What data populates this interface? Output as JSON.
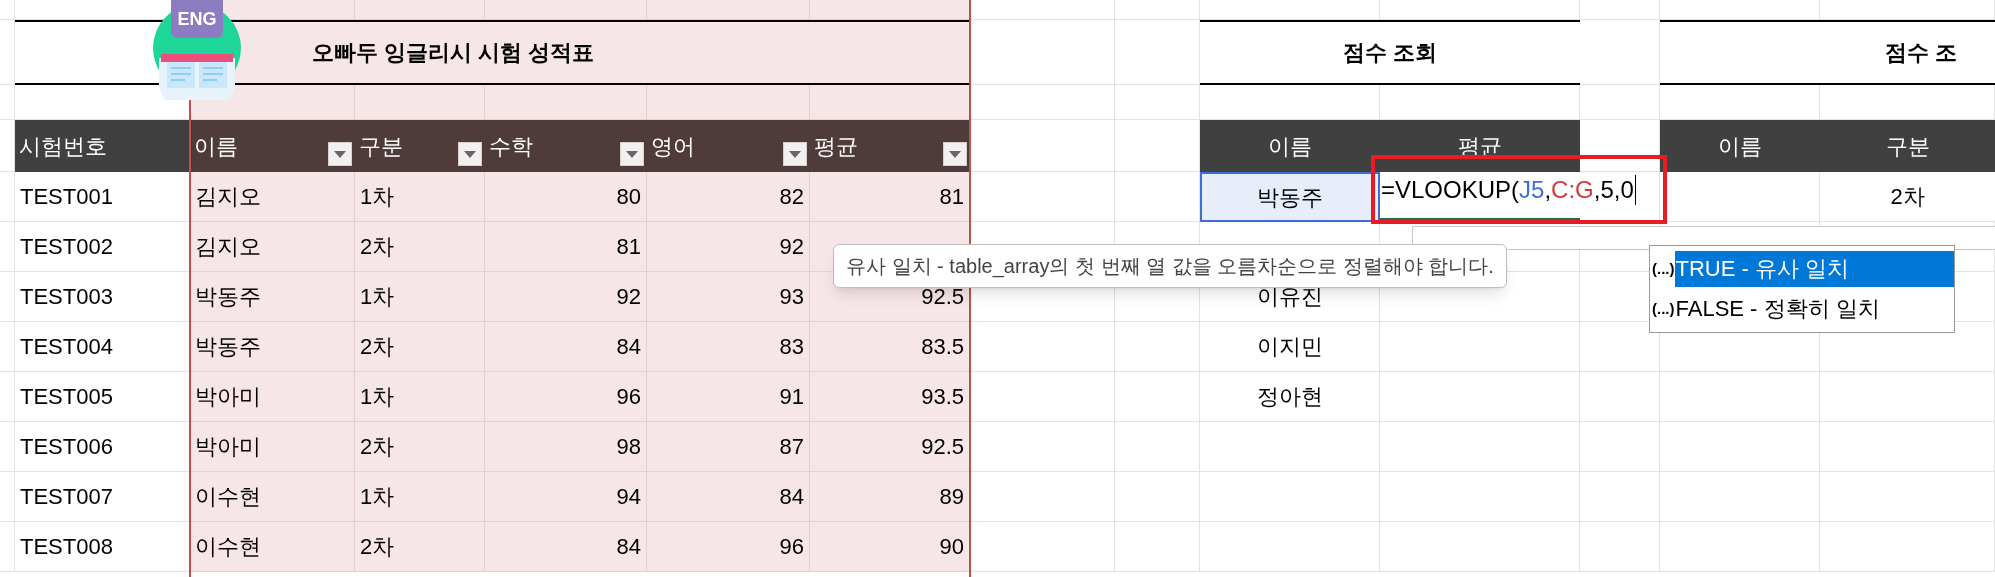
{
  "score_sheet": {
    "logo_badge": "ENG",
    "title": "오빠두 잉글리시 시험 성적표",
    "columns": [
      {
        "label": "시험번호",
        "filter": false
      },
      {
        "label": "이름",
        "filter": true
      },
      {
        "label": "구분",
        "filter": true
      },
      {
        "label": "수학",
        "filter": true
      },
      {
        "label": "영어",
        "filter": true
      },
      {
        "label": "평균",
        "filter": true
      }
    ],
    "rows": [
      [
        "TEST001",
        "김지오",
        "1차",
        "80",
        "82",
        "81"
      ],
      [
        "TEST002",
        "김지오",
        "2차",
        "81",
        "92"
      ],
      [
        "TEST003",
        "박동주",
        "1차",
        "92",
        "93",
        "92.5"
      ],
      [
        "TEST004",
        "박동주",
        "2차",
        "84",
        "83",
        "83.5"
      ],
      [
        "TEST005",
        "박아미",
        "1차",
        "96",
        "91",
        "93.5"
      ],
      [
        "TEST006",
        "박아미",
        "2차",
        "98",
        "87",
        "92.5"
      ],
      [
        "TEST007",
        "이수현",
        "1차",
        "94",
        "84",
        "89"
      ],
      [
        "TEST008",
        "이수현",
        "2차",
        "84",
        "96",
        "90"
      ]
    ]
  },
  "score_lookup": {
    "title": "점수 조회",
    "columns": [
      "이름",
      "평균"
    ],
    "names": [
      {
        "text": "박동주",
        "selected": true
      },
      {
        "selected": false
      },
      {
        "text": "이유진",
        "selected": false
      },
      {
        "text": "이지민",
        "selected": false
      },
      {
        "text": "정아현",
        "selected": false
      }
    ],
    "formula": [
      {
        "text": "=VLOOKUP("
      },
      {
        "text": "J5",
        "color": "#3b6fd6"
      },
      {
        "text": ","
      },
      {
        "text": "C:G",
        "color": "#d03a3a"
      },
      {
        "text": ",5,0"
      }
    ]
  },
  "score_lookup_2": {
    "title": "점수 조",
    "columns": [
      "이름",
      "구분"
    ],
    "rows": [
      {
        "type": "2차"
      }
    ]
  },
  "tooltip": "유사 일치 - table_array의 첫 번째 열 값을 오름차순으로 정렬해야 합니다.",
  "autocomplete": [
    {
      "marker": "(...)",
      "label": "TRUE - 유사 일치",
      "selected": true
    },
    {
      "marker": "(...)",
      "label": "FALSE - 정확히 일치",
      "selected": false
    }
  ]
}
